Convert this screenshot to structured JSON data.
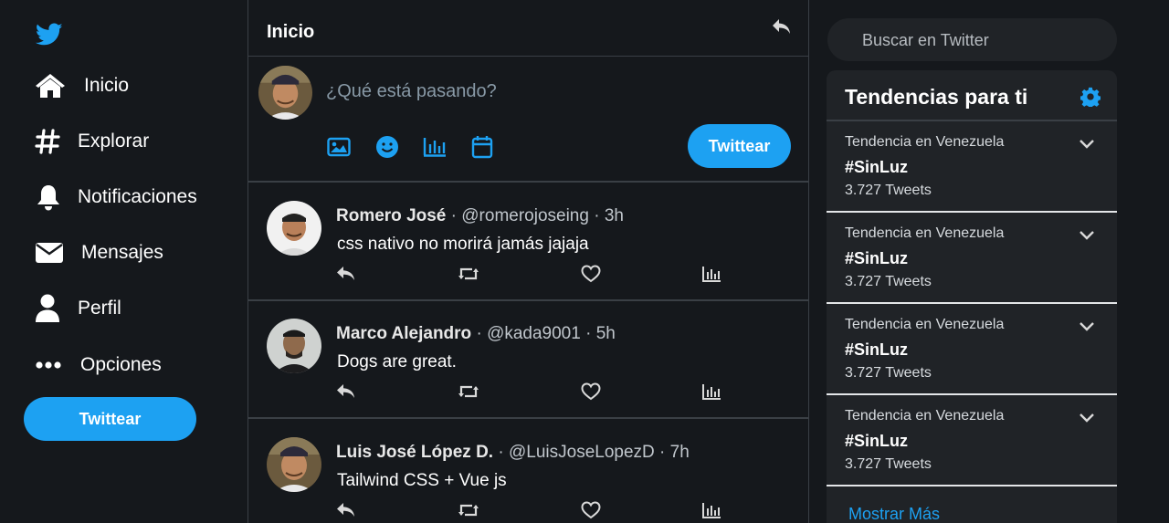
{
  "nav": {
    "items": [
      {
        "label": "Inicio",
        "icon": "home-icon"
      },
      {
        "label": "Explorar",
        "icon": "hashtag-icon"
      },
      {
        "label": "Notificaciones",
        "icon": "bell-icon"
      },
      {
        "label": "Mensajes",
        "icon": "envelope-icon"
      },
      {
        "label": "Perfil",
        "icon": "user-icon"
      },
      {
        "label": "Opciones",
        "icon": "more-icon"
      }
    ],
    "tweet_button": "Twittear"
  },
  "main": {
    "title": "Inicio",
    "composer": {
      "placeholder": "¿Qué está pasando?",
      "button": "Twittear",
      "tools": [
        "image-icon",
        "emoji-icon",
        "poll-icon",
        "schedule-icon"
      ]
    },
    "tweets": [
      {
        "name": "Romero José",
        "handle": "@romerojoseing",
        "time": "3h",
        "text": "css nativo no morirá jamás jajaja"
      },
      {
        "name": "Marco Alejandro",
        "handle": "@kada9001",
        "time": "5h",
        "text": "Dogs are great."
      },
      {
        "name": "Luis José López D.",
        "handle": "@LuisJoseLopezD",
        "time": "7h",
        "text": "Tailwind CSS + Vue js"
      }
    ],
    "separator": "·"
  },
  "right": {
    "search_placeholder": "Buscar en Twitter",
    "trends_title": "Tendencias para ti",
    "trends": [
      {
        "context": "Tendencia en Venezuela",
        "tag": "#SinLuz",
        "count": "3.727 Tweets"
      },
      {
        "context": "Tendencia en Venezuela",
        "tag": "#SinLuz",
        "count": "3.727 Tweets"
      },
      {
        "context": "Tendencia en Venezuela",
        "tag": "#SinLuz",
        "count": "3.727 Tweets"
      },
      {
        "context": "Tendencia en Venezuela",
        "tag": "#SinLuz",
        "count": "3.727 Tweets"
      }
    ],
    "show_more": "Mostrar Más"
  },
  "colors": {
    "background": "#15181c",
    "panel": "#202327",
    "accent": "#1da1f2",
    "border": "#3a3f45"
  }
}
